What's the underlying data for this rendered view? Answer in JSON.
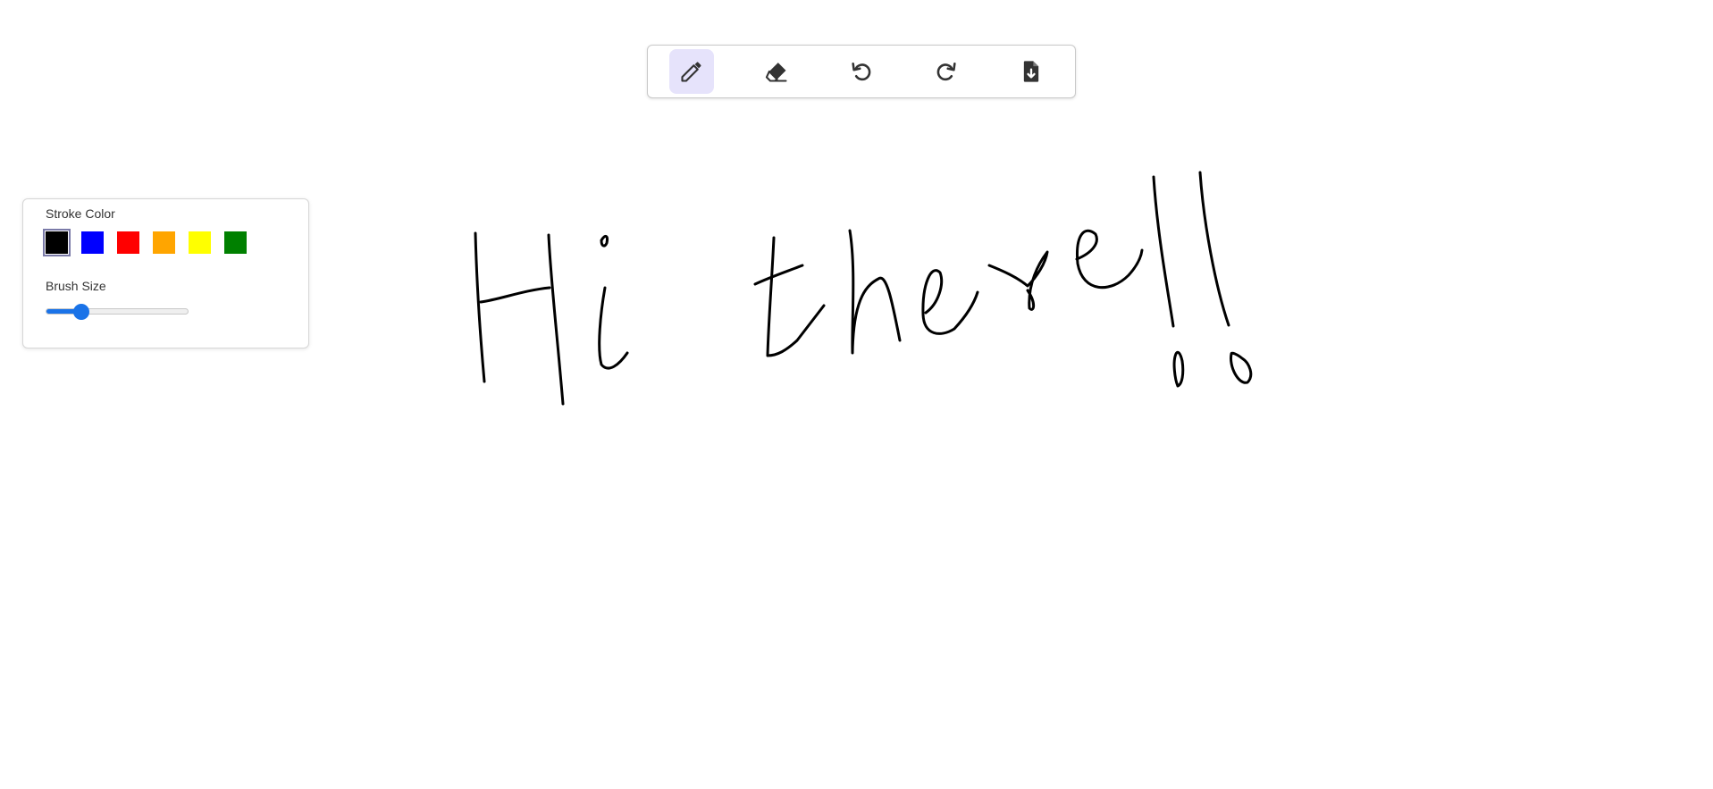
{
  "toolbar": {
    "tools": [
      {
        "id": "pencil",
        "icon": "pencil-icon",
        "active": true
      },
      {
        "id": "eraser",
        "icon": "eraser-icon",
        "active": false
      },
      {
        "id": "undo",
        "icon": "undo-icon",
        "active": false
      },
      {
        "id": "redo",
        "icon": "redo-icon",
        "active": false
      },
      {
        "id": "save",
        "icon": "file-download-icon",
        "active": false
      }
    ]
  },
  "panel": {
    "stroke_color_label": "Stroke Color",
    "colors": [
      "#000000",
      "#0000ff",
      "#ff0000",
      "#ffa500",
      "#ffff00",
      "#008000"
    ],
    "selected_color": "#000000",
    "brush_size_label": "Brush Size",
    "brush_size_fraction": 0.25
  },
  "canvas": {
    "background": "#ffffff",
    "stroke_color": "#000000",
    "handwritten_text": "Hi there!!"
  },
  "colors": {
    "accent": "#1a73e8",
    "active_tool_bg": "#e6e3fb",
    "icon": "#333333"
  }
}
